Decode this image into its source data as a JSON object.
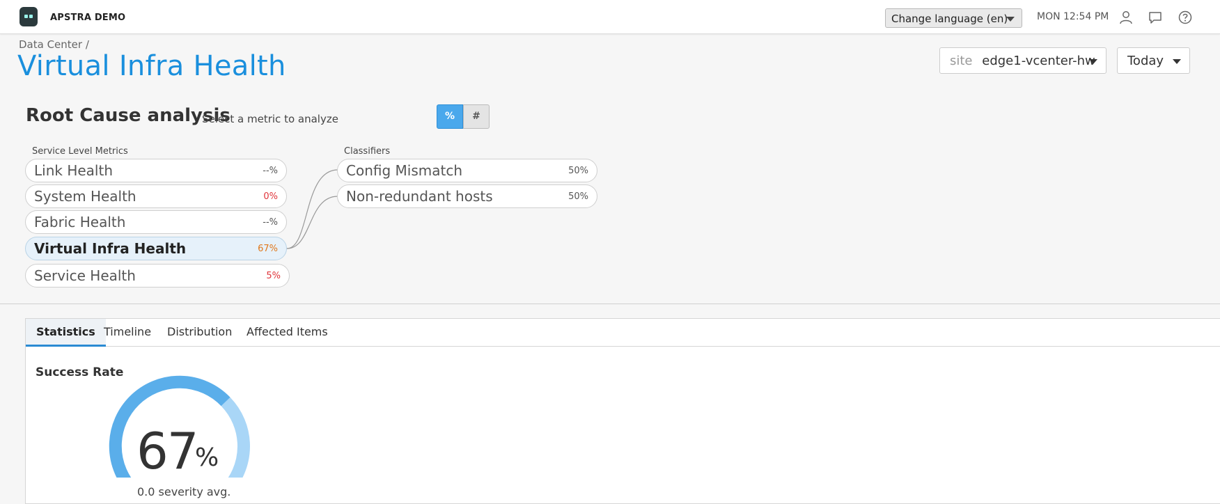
{
  "app": {
    "title": "APSTRA DEMO"
  },
  "topbar": {
    "language_select": "Change language (en)",
    "clock": "MON 12:54 PM",
    "icons": [
      "user-icon",
      "chat-icon",
      "help-icon"
    ]
  },
  "header": {
    "breadcrumb": "Data Center /",
    "title": "Virtual Infra Health",
    "site_label": "site",
    "site_value": "edge1-vcenter-hw",
    "time_range": "Today"
  },
  "root_cause": {
    "title": "Root Cause analysis",
    "subtitle": "Select a metric to analyze",
    "toggle_percent": "%",
    "toggle_count": "#",
    "service_label": "Service Level Metrics",
    "classifiers_label": "Classifiers",
    "metrics": [
      {
        "name": "Link Health",
        "value": "--%"
      },
      {
        "name": "System Health",
        "value": "0%"
      },
      {
        "name": "Fabric Health",
        "value": "--%"
      },
      {
        "name": "Virtual Infra Health",
        "value": "67%"
      },
      {
        "name": "Service Health",
        "value": "5%"
      }
    ],
    "classifiers": [
      {
        "name": "Config Mismatch",
        "value": "50%"
      },
      {
        "name": "Non-redundant hosts",
        "value": "50%"
      }
    ]
  },
  "tabs": [
    "Statistics",
    "Timeline",
    "Distribution",
    "Affected Items"
  ],
  "statistics": {
    "title": "Success Rate",
    "value": "67",
    "unit": "%",
    "fraction": 0.67,
    "subtext": "0.0 severity avg."
  },
  "colors": {
    "accent": "#1a8fdd",
    "gauge_primary": "#5aaeea",
    "gauge_secondary": "#a9d6f7",
    "red": "#e0353b",
    "orange": "#e0781c"
  }
}
